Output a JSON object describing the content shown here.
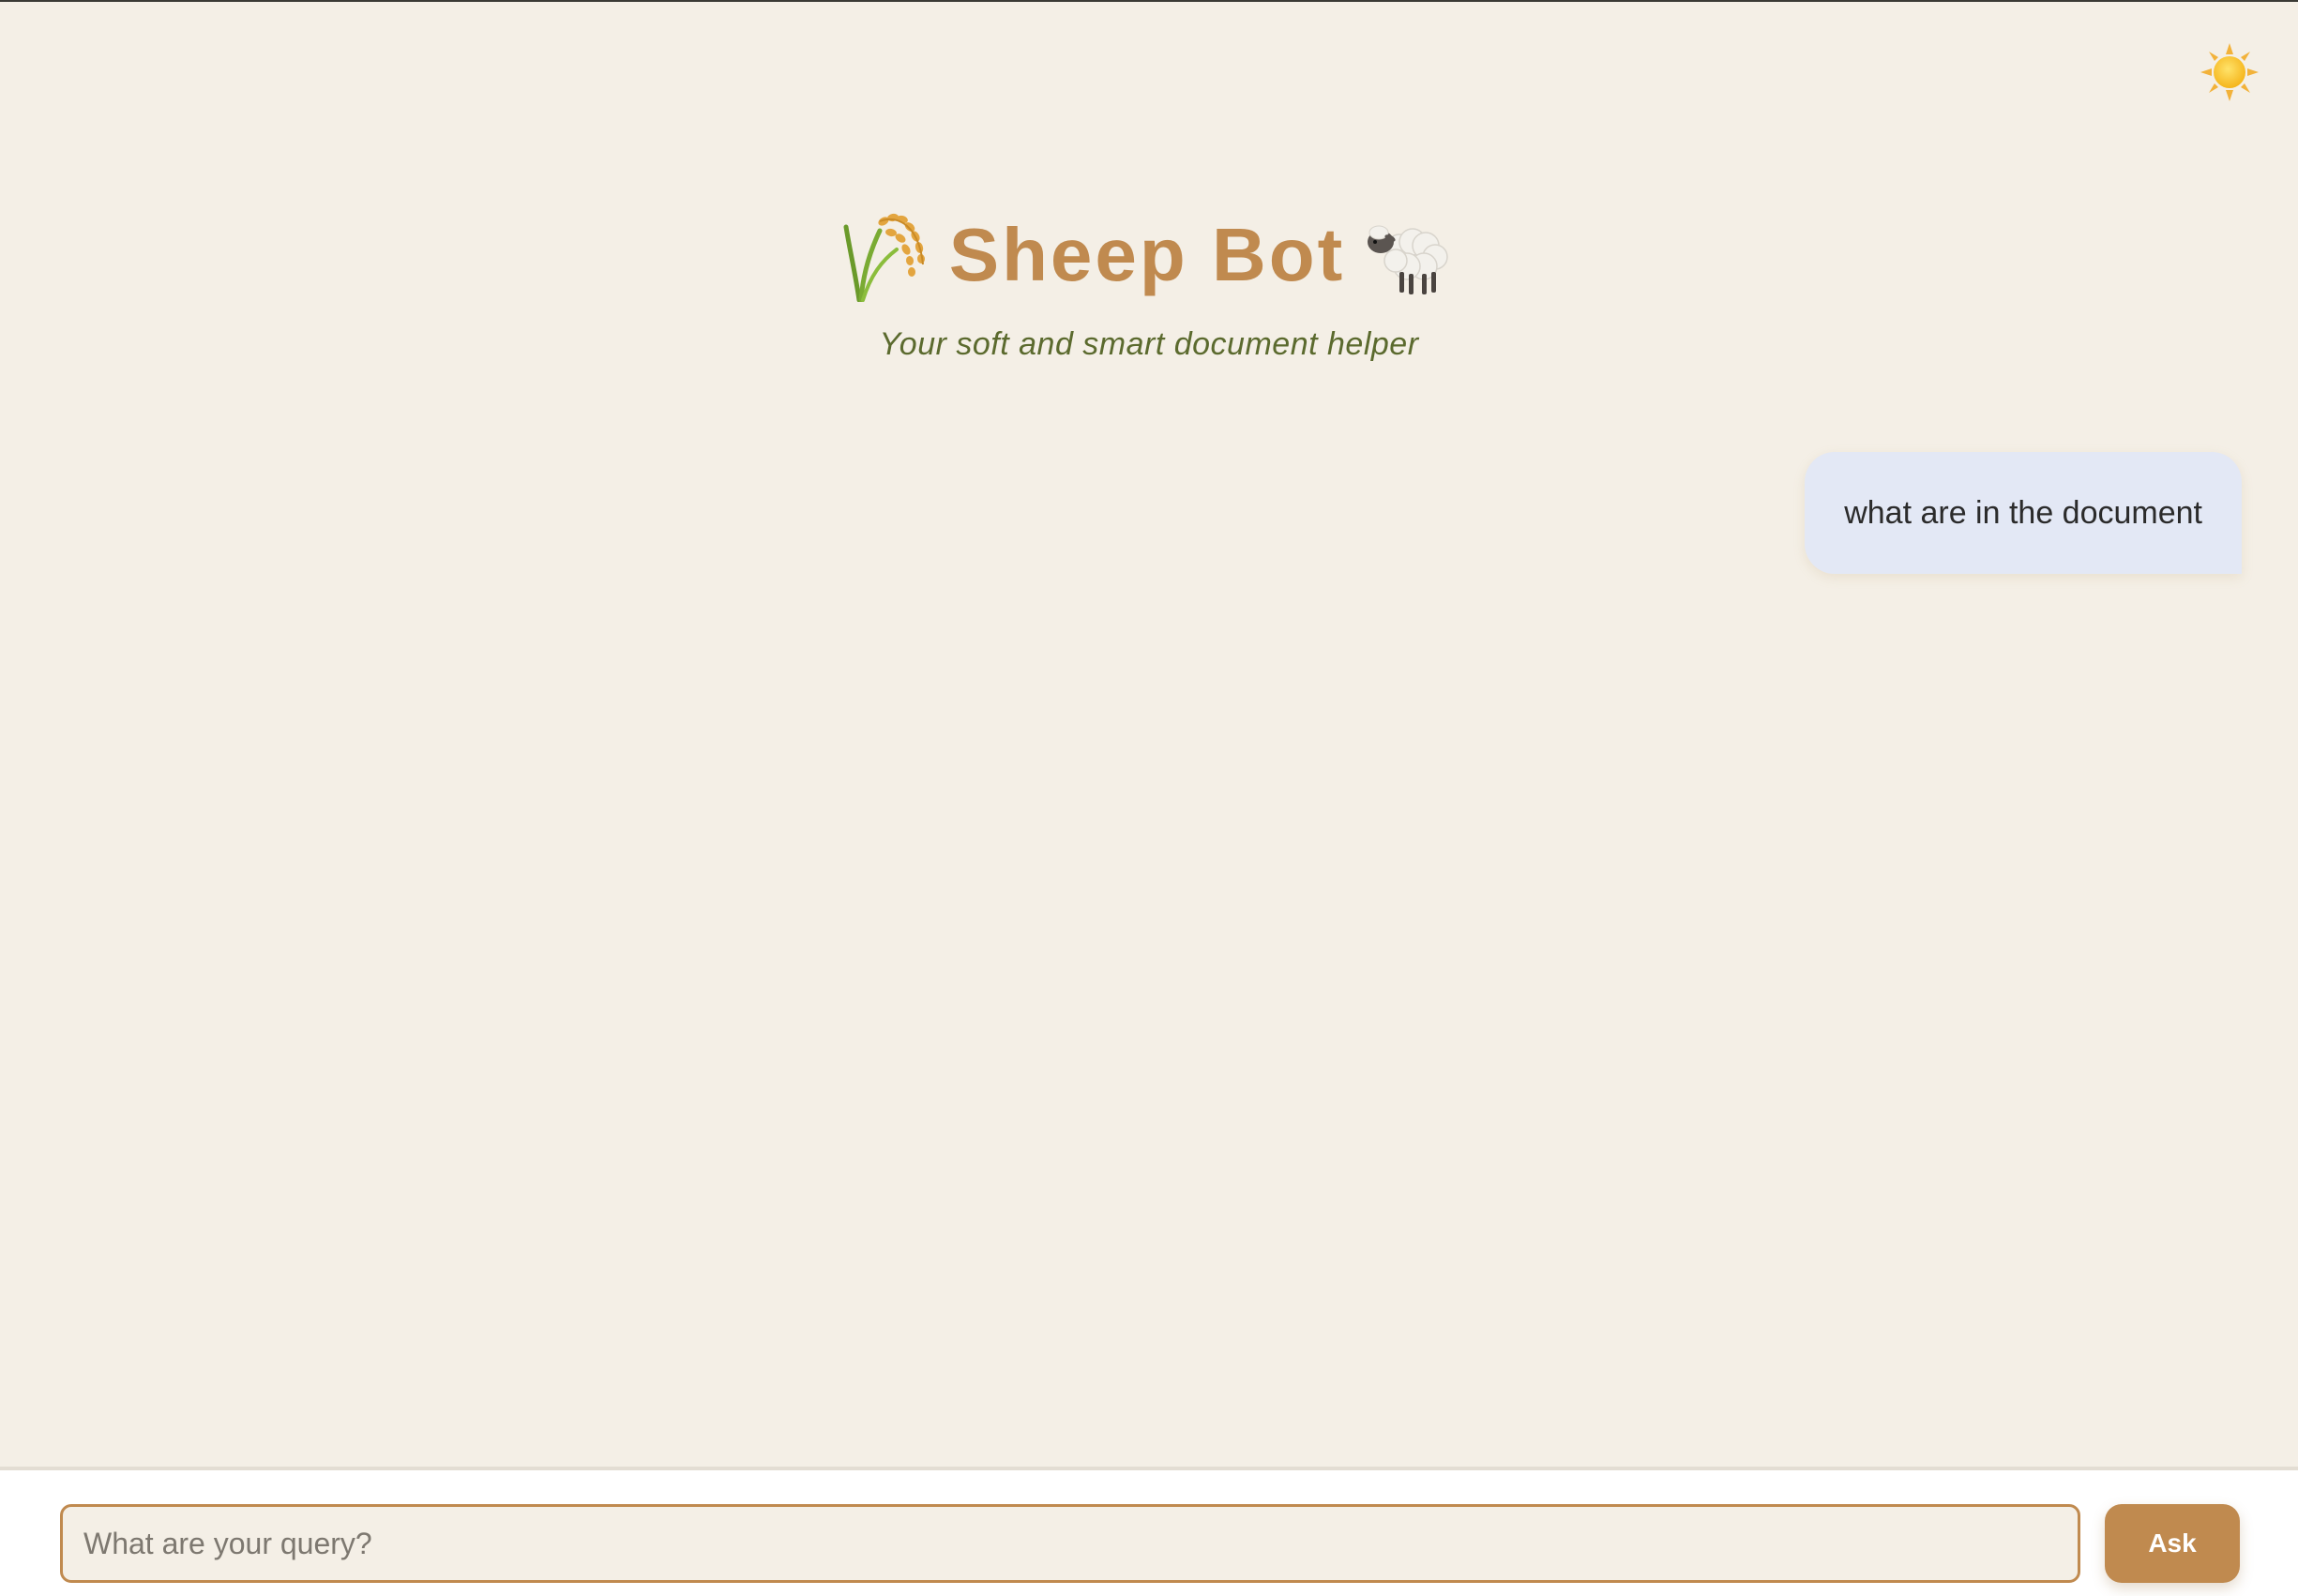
{
  "header": {
    "title": "Sheep Bot",
    "subtitle": "Your soft and smart document helper",
    "left_icon": "rice-sheaf-icon",
    "right_icon": "sheep-icon"
  },
  "theme_toggle": {
    "icon": "sun-icon"
  },
  "chat": {
    "messages": [
      {
        "role": "user",
        "text": "what are in the document"
      }
    ]
  },
  "input_bar": {
    "placeholder": "What are your query?",
    "value": "",
    "ask_label": "Ask"
  },
  "colors": {
    "background": "#f4efe6",
    "accent": "#c08a4f",
    "subtitle": "#5b6a2e",
    "user_bubble": "#e3e8f5"
  }
}
